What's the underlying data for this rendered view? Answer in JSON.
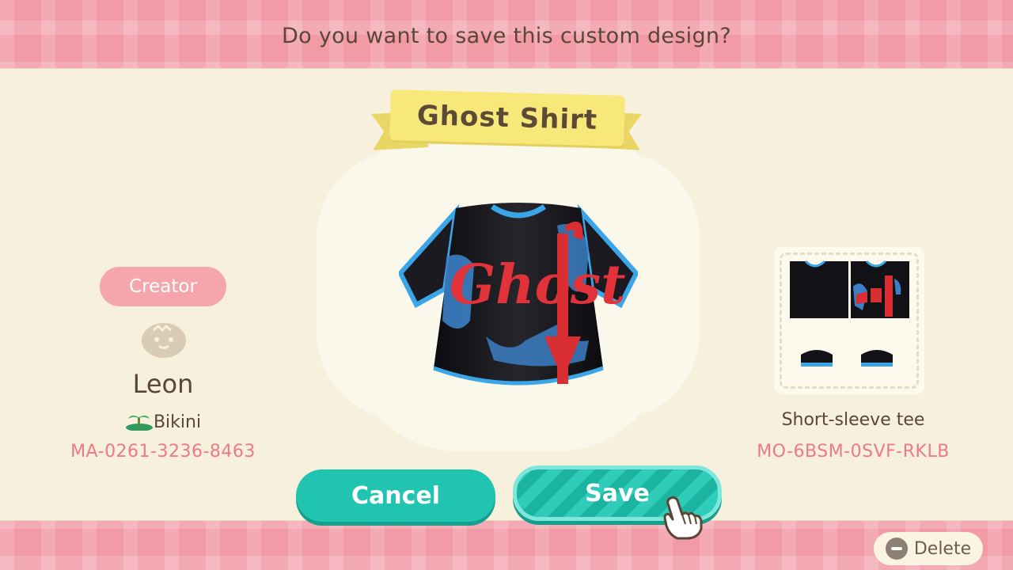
{
  "prompt": "Do you want to save this custom design?",
  "design": {
    "title": "Ghost Shirt",
    "type": "Short-sleeve tee",
    "design_id": "MO-6BSM-0SVF-RKLB",
    "shirt_text": "Ghost"
  },
  "creator": {
    "label": "Creator",
    "name": "Leon",
    "island": "Bikini",
    "creator_id": "MA-0261-3236-8463"
  },
  "buttons": {
    "cancel": "Cancel",
    "save": "Save",
    "delete": "Delete"
  },
  "colors": {
    "background": "#f29aa6",
    "panel": "#f7f0dc",
    "accent_teal": "#21c4b0",
    "ribbon": "#f7e879",
    "id_text": "#ec7a83"
  },
  "icons": {
    "creator_avatar": "villager-face-icon",
    "island": "island-palm-icon",
    "cursor": "pointing-hand-icon",
    "delete": "minus-button-icon"
  }
}
